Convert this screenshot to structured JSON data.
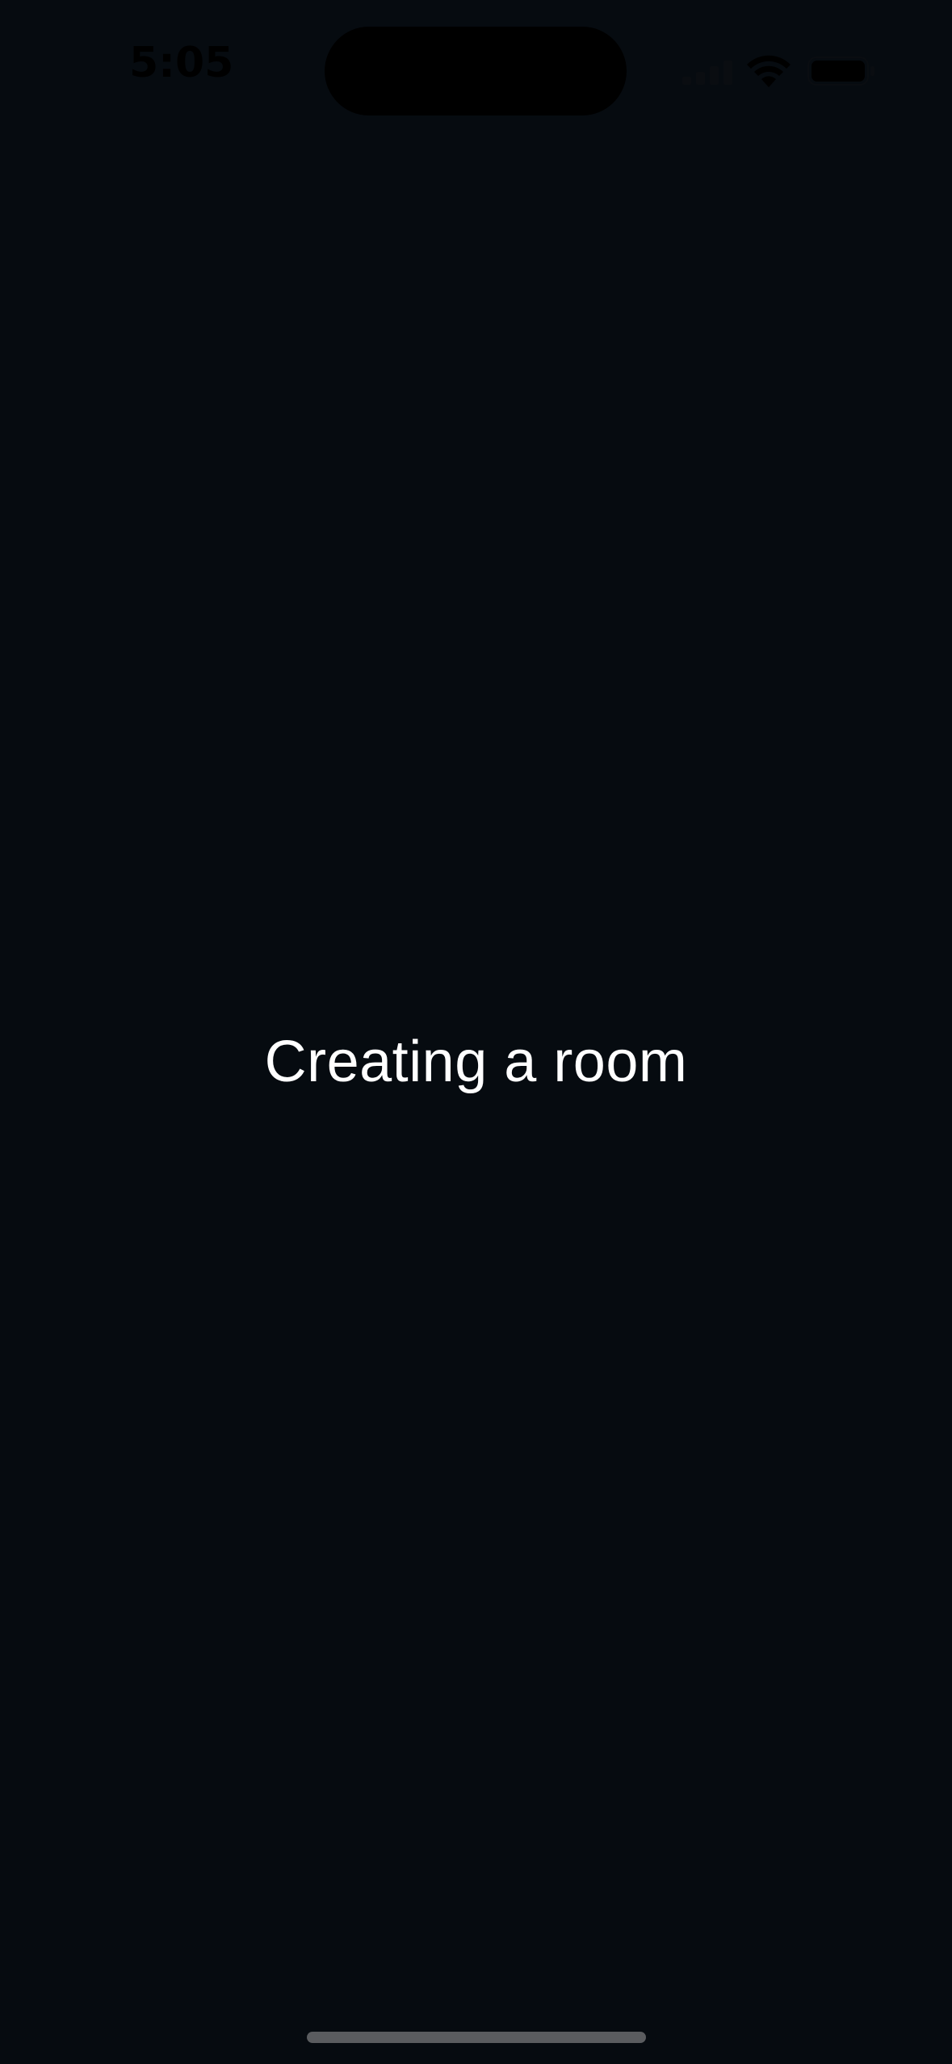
{
  "status_bar": {
    "time": "5:05",
    "icons": [
      "cellular-signal-icon",
      "wifi-icon",
      "battery-icon"
    ]
  },
  "main": {
    "loading_message": "Creating a room"
  },
  "colors": {
    "background": "#060b10",
    "text": "#ffffff",
    "home_indicator": "#5a5c5f"
  }
}
